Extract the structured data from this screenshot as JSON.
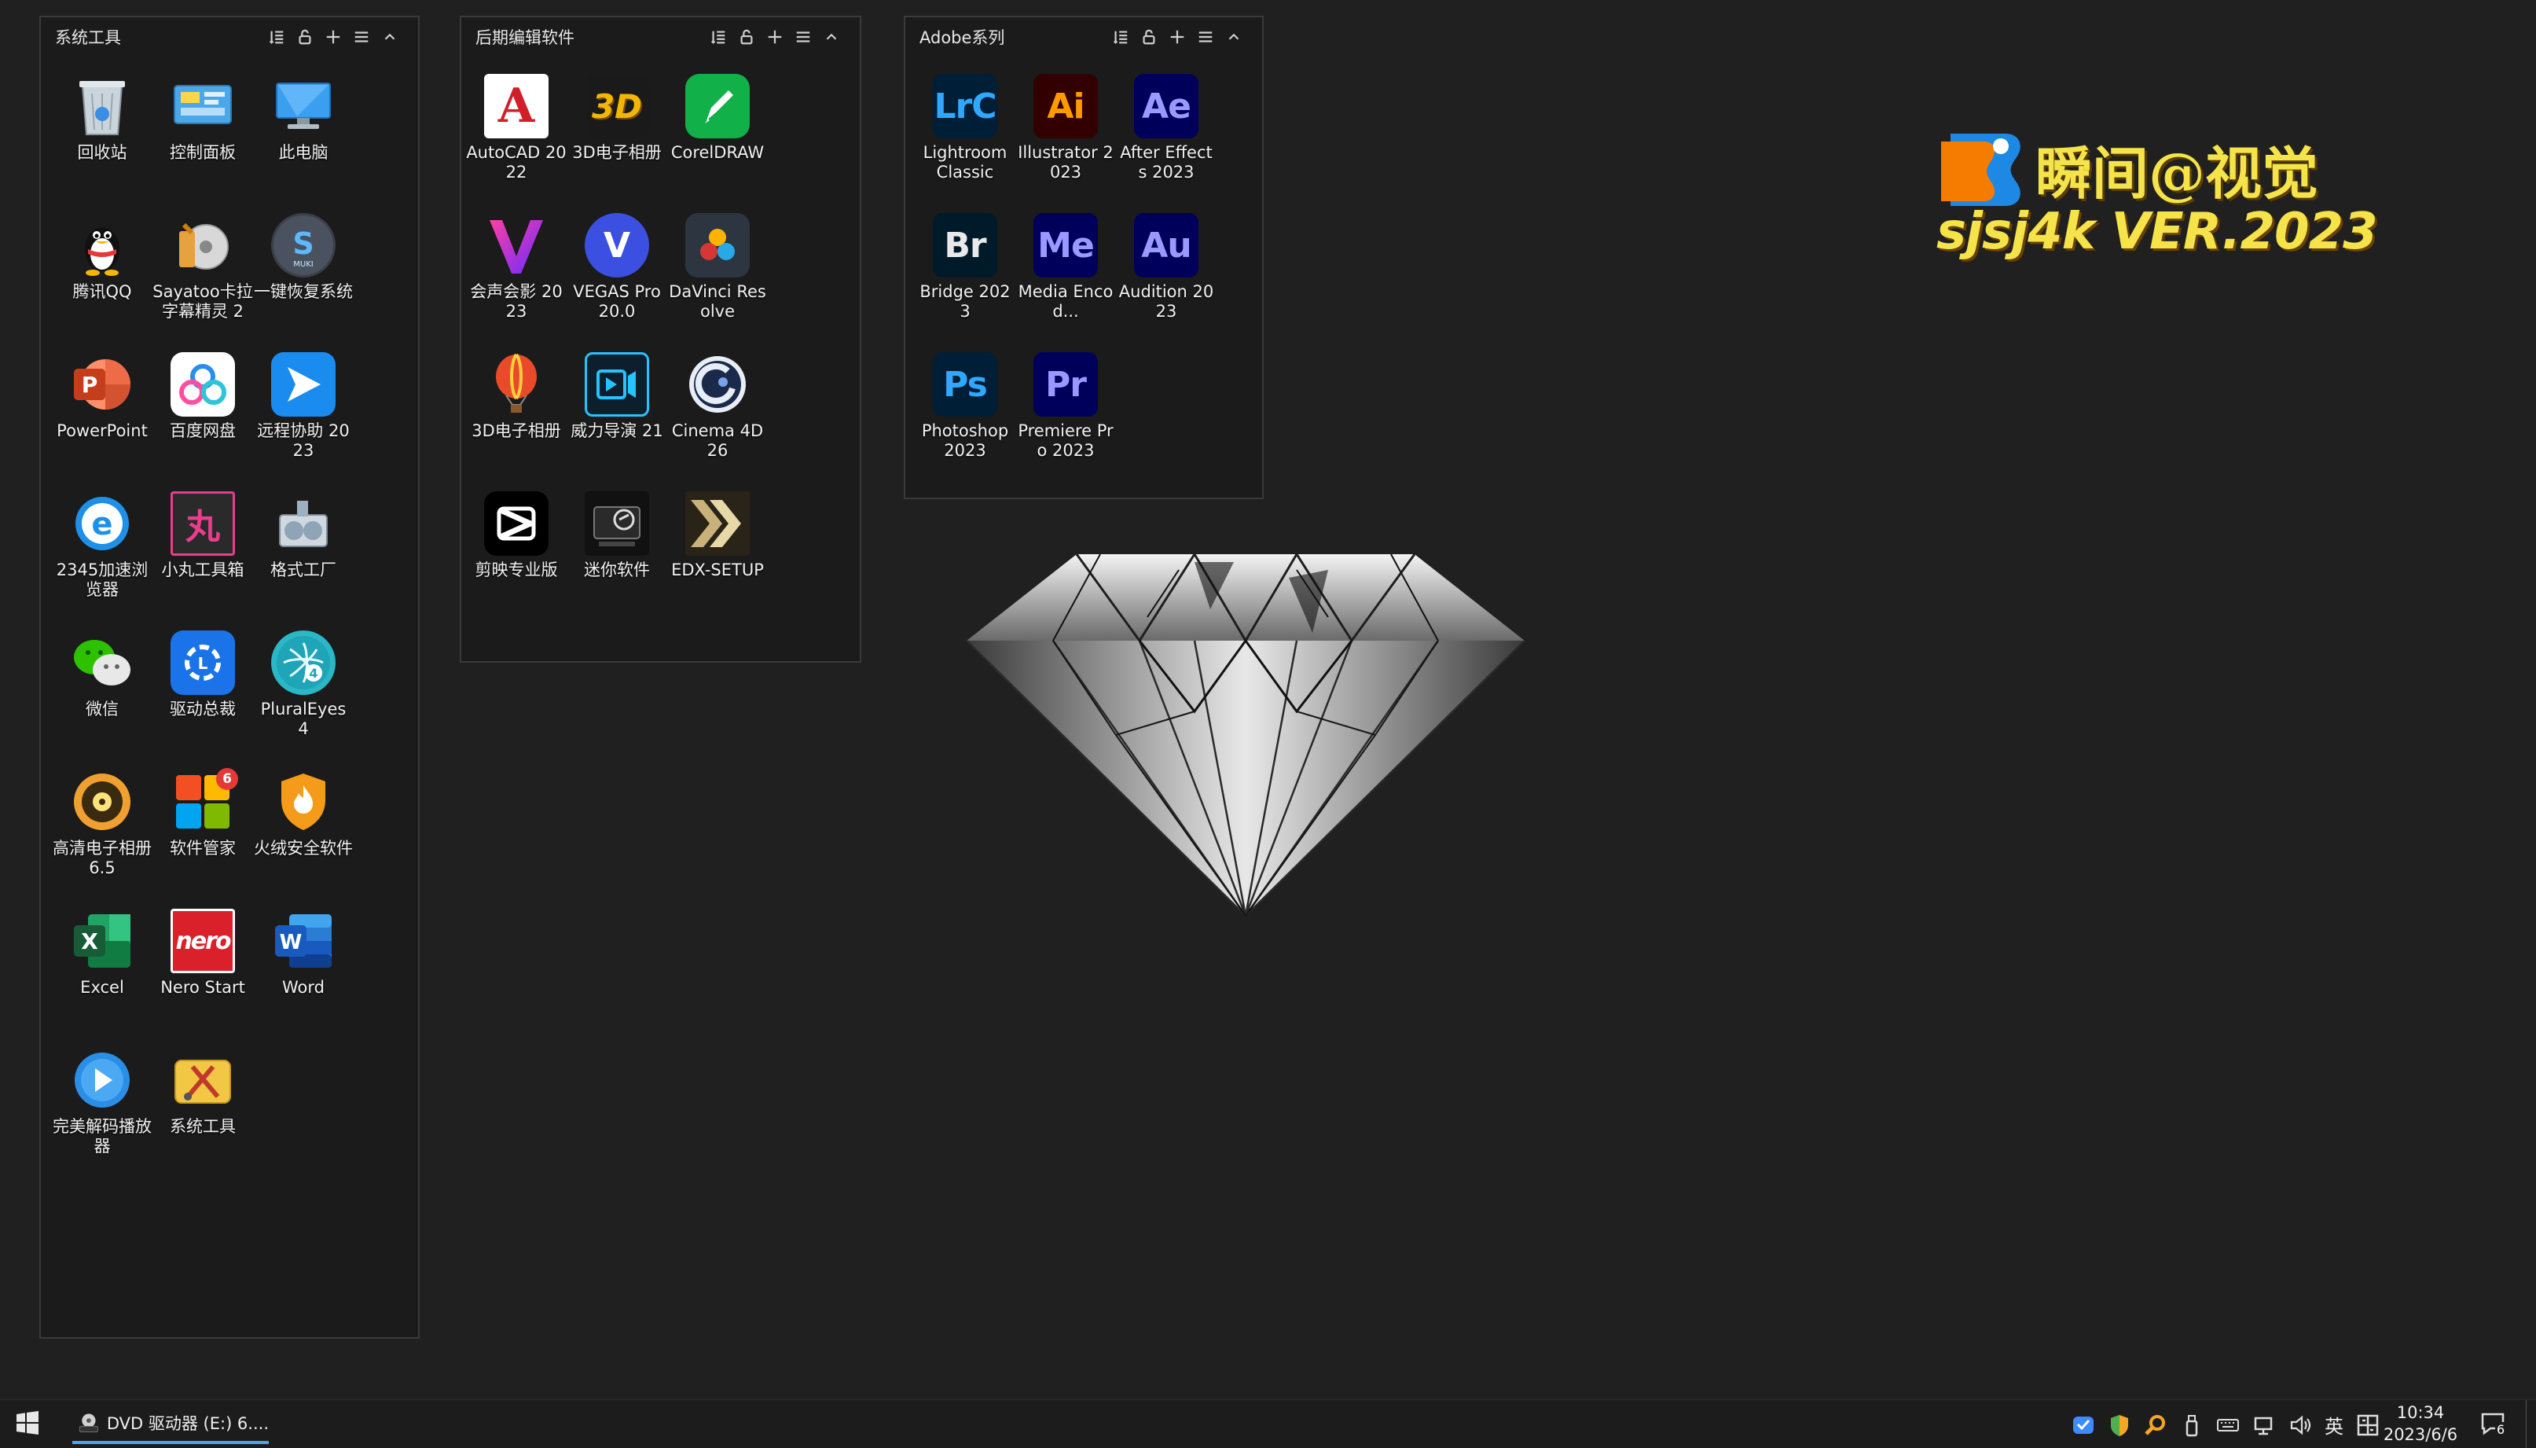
{
  "fences": [
    {
      "title": "系统工具",
      "items": [
        {
          "label": "回收站",
          "icon": "recycle-bin-icon"
        },
        {
          "label": "控制面板",
          "icon": "control-panel-icon"
        },
        {
          "label": "此电脑",
          "icon": "this-pc-icon"
        },
        {
          "label": "腾讯QQ",
          "icon": "qq-penguin-icon"
        },
        {
          "label": "Sayatoo卡拉字幕精灵 2",
          "icon": "sayatoo-icon"
        },
        {
          "label": "一键恢复系统",
          "icon": "system-restore-icon"
        },
        {
          "label": "PowerPoint",
          "icon": "powerpoint-icon"
        },
        {
          "label": "百度网盘",
          "icon": "baidu-netdisk-icon"
        },
        {
          "label": "远程协助 2023",
          "icon": "remote-assist-icon"
        },
        {
          "label": "2345加速浏览器",
          "icon": "browser-2345-icon"
        },
        {
          "label": "小丸工具箱",
          "icon": "xiaowan-toolbox-icon"
        },
        {
          "label": "格式工厂",
          "icon": "format-factory-icon"
        },
        {
          "label": "微信",
          "icon": "wechat-icon"
        },
        {
          "label": "驱动总裁",
          "icon": "driver-president-icon"
        },
        {
          "label": "PluralEyes 4",
          "icon": "pluraleyes-icon"
        },
        {
          "label": "高清电子相册 6.5",
          "icon": "hd-album-icon"
        },
        {
          "label": "软件管家",
          "icon": "software-manager-icon",
          "badge": "6"
        },
        {
          "label": "火绒安全软件",
          "icon": "huorong-shield-icon"
        },
        {
          "label": "Excel",
          "icon": "excel-icon"
        },
        {
          "label": "Nero Start",
          "icon": "nero-icon"
        },
        {
          "label": "Word",
          "icon": "word-icon"
        },
        {
          "label": "完美解码播放器",
          "icon": "potplayer-icon"
        },
        {
          "label": "系统工具",
          "icon": "system-tools-icon"
        }
      ]
    },
    {
      "title": "后期编辑软件",
      "items": [
        {
          "label": "AutoCAD 2022",
          "icon": "autocad-icon"
        },
        {
          "label": "3D电子相册",
          "icon": "3d-album-icon"
        },
        {
          "label": "CorelDRAW",
          "icon": "coreldraw-icon"
        },
        {
          "label": "会声会影 2023",
          "icon": "videostudio-icon"
        },
        {
          "label": "VEGAS Pro 20.0",
          "icon": "vegas-icon"
        },
        {
          "label": "DaVinci Resolve",
          "icon": "davinci-icon"
        },
        {
          "label": "3D电子相册",
          "icon": "balloon-album-icon"
        },
        {
          "label": "威力导演 21",
          "icon": "powerdirector-icon"
        },
        {
          "label": "Cinema 4D 26",
          "icon": "cinema4d-icon"
        },
        {
          "label": "剪映专业版",
          "icon": "capcut-icon"
        },
        {
          "label": "迷你软件",
          "icon": "mini-software-icon"
        },
        {
          "label": "EDX-SETUP",
          "icon": "edx-setup-icon"
        }
      ]
    },
    {
      "title": "Adobe系列",
      "items": [
        {
          "label": "Lightroom Classic",
          "icon": "lightroom-icon",
          "abbr": "LrC"
        },
        {
          "label": "Illustrator 2023",
          "icon": "illustrator-icon",
          "abbr": "Ai"
        },
        {
          "label": "After Effects 2023",
          "icon": "after-effects-icon",
          "abbr": "Ae"
        },
        {
          "label": "Bridge 2023",
          "icon": "bridge-icon",
          "abbr": "Br"
        },
        {
          "label": "Media Encod...",
          "icon": "media-encoder-icon",
          "abbr": "Me"
        },
        {
          "label": "Audition 2023",
          "icon": "audition-icon",
          "abbr": "Au"
        },
        {
          "label": "Photoshop 2023",
          "icon": "photoshop-icon",
          "abbr": "Ps"
        },
        {
          "label": "Premiere Pro 2023",
          "icon": "premiere-icon",
          "abbr": "Pr"
        }
      ]
    }
  ],
  "watermark": {
    "cn": "瞬间@视觉",
    "en": "sjsj4k VER.2023"
  },
  "taskbar": {
    "window_label": "DVD 驱动器 (E:) 6....",
    "ime": "英",
    "time": "10:34",
    "date": "2023/6/6",
    "notification_count": "6"
  },
  "colors": {
    "desktop": "#202020",
    "fence": "#1b1b1b",
    "watermark": "#f5e34a"
  }
}
